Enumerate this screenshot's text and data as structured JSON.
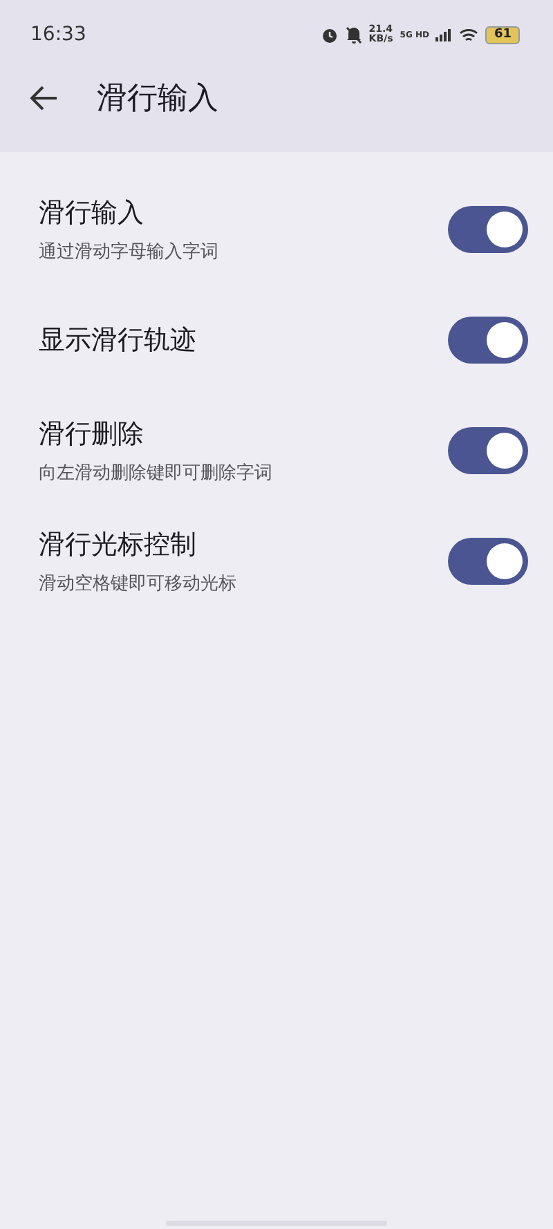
{
  "status_bar": {
    "time": "16:33",
    "net_speed": "21.4",
    "net_unit": "KB/s",
    "network": "5G HD",
    "battery": "61"
  },
  "header": {
    "title": "滑行输入"
  },
  "settings": [
    {
      "title": "滑行输入",
      "subtitle": "通过滑动字母输入字词",
      "on": true
    },
    {
      "title": "显示滑行轨迹",
      "on": true
    },
    {
      "title": "滑行删除",
      "subtitle": "向左滑动删除键即可删除字词",
      "on": true
    },
    {
      "title": "滑行光标控制",
      "subtitle": "滑动空格键即可移动光标",
      "on": true
    }
  ]
}
